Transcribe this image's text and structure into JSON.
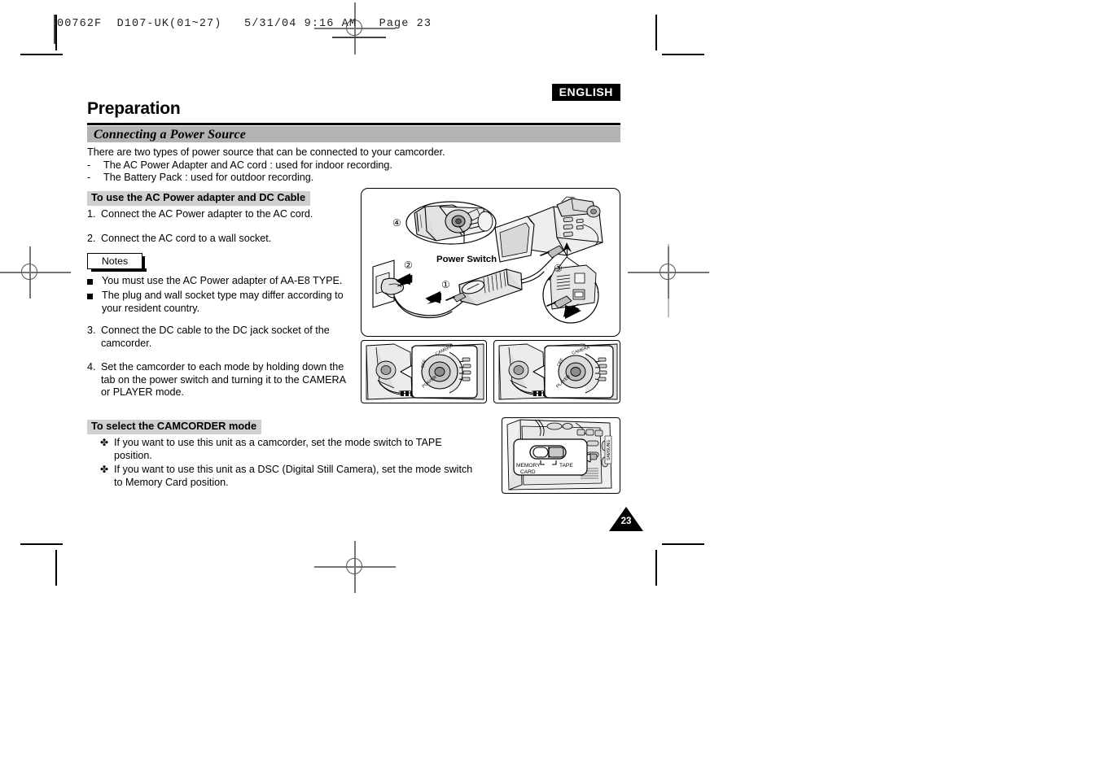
{
  "prepress": {
    "slug": "00762F  D107-UK(01~27)   5/31/04 9:16 AM   Page 23"
  },
  "header": {
    "language_badge": "ENGLISH",
    "title": "Preparation",
    "section_bar": "Connecting a Power Source"
  },
  "intro": {
    "lead": "There are two types of power source that can be connected to your camcorder.",
    "dash": "-",
    "items": [
      "The AC Power Adapter and AC cord : used for indoor recording.",
      "The Battery Pack : used for outdoor recording."
    ]
  },
  "section_ac": {
    "heading": "To use the AC Power adapter and DC Cable",
    "steps_top": [
      {
        "num": "1.",
        "text": "Connect the AC Power adapter to the AC cord."
      },
      {
        "num": "2.",
        "text": "Connect the AC cord to a wall socket."
      }
    ],
    "notes_label": "Notes",
    "notes": [
      "You must use the AC Power adapter of AA-E8 TYPE.",
      "The plug and wall socket type may differ according to your resident country."
    ],
    "steps_bottom": [
      {
        "num": "3.",
        "text": "Connect the DC cable to the DC jack socket of the camcorder."
      },
      {
        "num": "4.",
        "text": "Set the camcorder to each mode by holding down the tab on the power switch and turning it to the CAMERA or PLAYER mode."
      }
    ]
  },
  "section_camcorder": {
    "heading": "To select the CAMCORDER mode",
    "bullet_mark": "✤",
    "bullets": [
      "If you want to use this unit as a camcorder, set the mode switch to TAPE position.",
      "If you want to use this unit as a DSC (Digital Still Camera), set the mode switch to Memory Card position."
    ]
  },
  "figures": {
    "main": {
      "power_switch_label": "Power Switch",
      "callouts": [
        "①",
        "②",
        "③",
        "④"
      ]
    },
    "dial_left": {
      "labels": [
        "CAMERA",
        "OFF",
        "PLAYER"
      ]
    },
    "dial_right": {
      "labels": [
        "CAMERA",
        "OFF",
        "PLAYER"
      ]
    },
    "mode_switch": {
      "left_label_line1": "MEMORY",
      "left_label_line2": "CARD",
      "right_label": "TAPE",
      "brand": "SAMSUNG"
    }
  },
  "footer": {
    "page_number": "23"
  },
  "colors": {
    "section_bar_gray": "#b3b3b3",
    "subhead_gray": "#cfcfcf",
    "ink": "#000000"
  }
}
